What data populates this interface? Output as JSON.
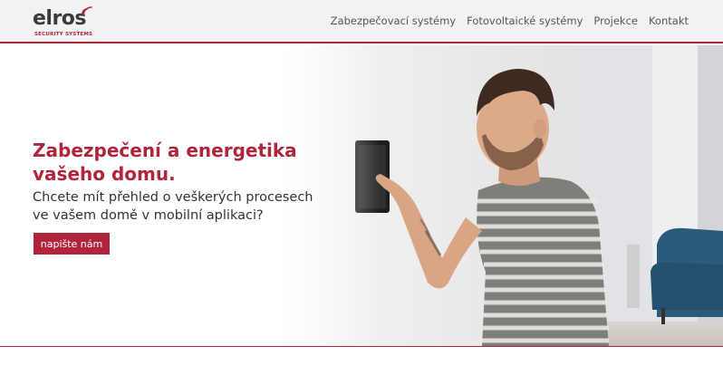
{
  "header": {
    "logo_text": "elros",
    "logo_subtitle": "SECURITY SYSTEMS",
    "nav": [
      {
        "label": "Zabezpečovací systémy"
      },
      {
        "label": "Fotovoltaické systémy"
      },
      {
        "label": "Projekce"
      },
      {
        "label": "Kontakt"
      }
    ]
  },
  "hero": {
    "headline": "Zabezpečení a energetika vašeho domu.",
    "subtext": "Chcete mít přehled o veškerých procesech ve vašem domě v mobilní aplikaci?",
    "cta_label": "napište nám"
  },
  "colors": {
    "accent": "#b0243c",
    "nav_text": "#555555",
    "body_text": "#333333",
    "header_bg": "#f2f2f2"
  },
  "icons": [
    "signal-waves-icon"
  ]
}
